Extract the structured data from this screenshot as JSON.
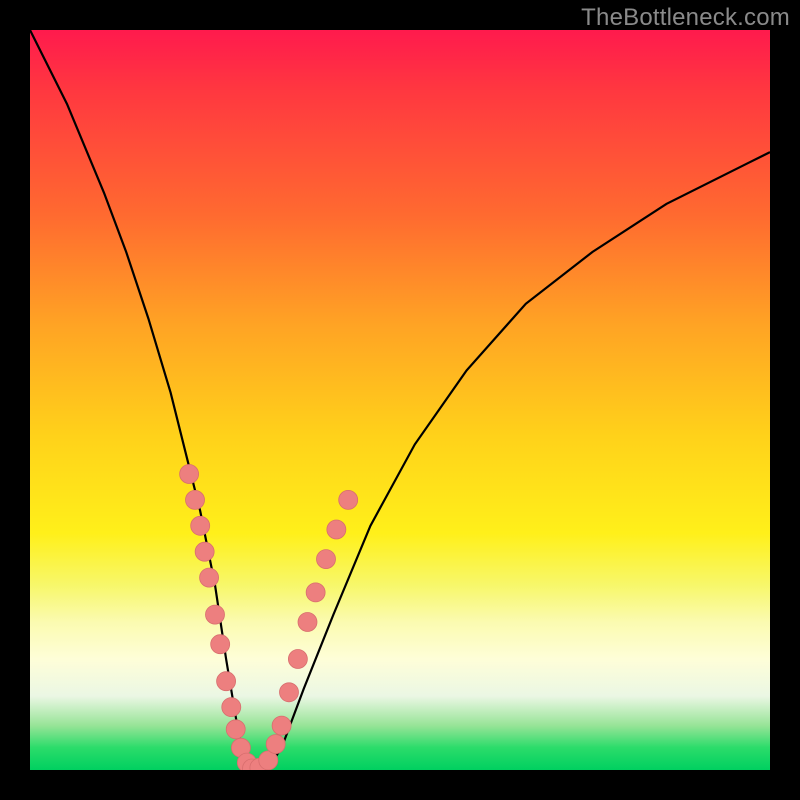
{
  "watermark": "TheBottleneck.com",
  "colors": {
    "marker_fill": "#ed7f7f",
    "marker_stroke": "#d86e6e",
    "curve_stroke": "#000000"
  },
  "chart_data": {
    "type": "line",
    "title": "",
    "xlabel": "",
    "ylabel": "",
    "xlim": [
      0,
      100
    ],
    "ylim": [
      0,
      100
    ],
    "curve": {
      "x": [
        0,
        5,
        10,
        13,
        16,
        19,
        21,
        23,
        25,
        26.5,
        28,
        29,
        30,
        32,
        34,
        37,
        41,
        46,
        52,
        59,
        67,
        76,
        86,
        97,
        100
      ],
      "y": [
        100,
        90,
        78,
        70,
        61,
        51,
        43,
        35,
        25,
        15,
        6,
        1,
        0,
        0,
        3,
        11,
        21,
        33,
        44,
        54,
        63,
        70,
        76.5,
        82,
        83.5
      ]
    },
    "markers": [
      {
        "x": 21.5,
        "y": 40.0
      },
      {
        "x": 22.3,
        "y": 36.5
      },
      {
        "x": 23.0,
        "y": 33.0
      },
      {
        "x": 23.6,
        "y": 29.5
      },
      {
        "x": 24.2,
        "y": 26.0
      },
      {
        "x": 25.0,
        "y": 21.0
      },
      {
        "x": 25.7,
        "y": 17.0
      },
      {
        "x": 26.5,
        "y": 12.0
      },
      {
        "x": 27.2,
        "y": 8.5
      },
      {
        "x": 27.8,
        "y": 5.5
      },
      {
        "x": 28.5,
        "y": 3.0
      },
      {
        "x": 29.3,
        "y": 1.0
      },
      {
        "x": 30.0,
        "y": 0.2
      },
      {
        "x": 31.0,
        "y": 0.3
      },
      {
        "x": 32.2,
        "y": 1.3
      },
      {
        "x": 33.2,
        "y": 3.5
      },
      {
        "x": 34.0,
        "y": 6.0
      },
      {
        "x": 35.0,
        "y": 10.5
      },
      {
        "x": 36.2,
        "y": 15.0
      },
      {
        "x": 37.5,
        "y": 20.0
      },
      {
        "x": 38.6,
        "y": 24.0
      },
      {
        "x": 40.0,
        "y": 28.5
      },
      {
        "x": 41.4,
        "y": 32.5
      },
      {
        "x": 43.0,
        "y": 36.5
      }
    ]
  }
}
